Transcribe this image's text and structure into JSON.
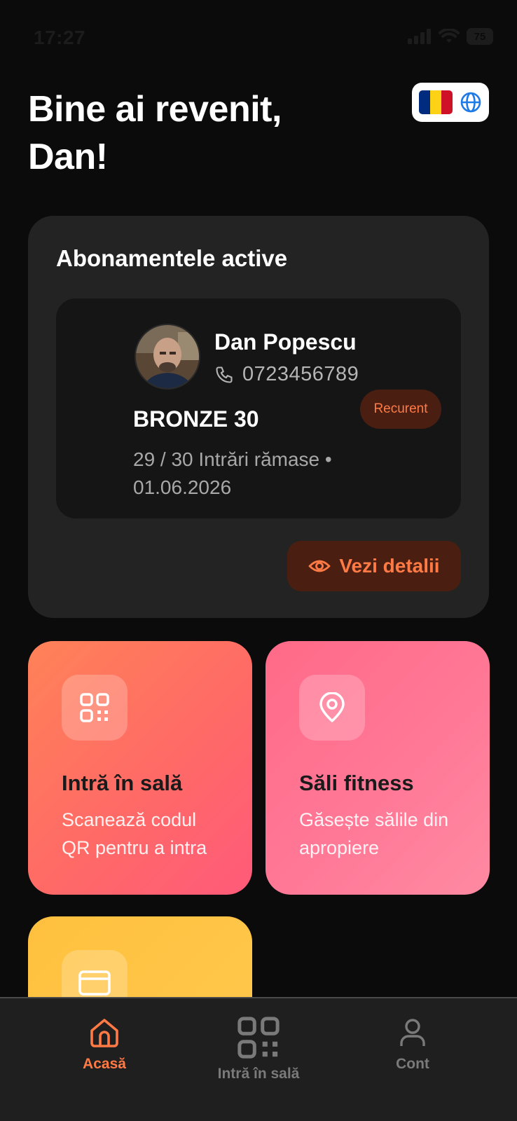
{
  "status_bar": {
    "time": "17:27",
    "battery": "75"
  },
  "greeting": "Bine ai revenit, Dan!",
  "subscriptions": {
    "title": "Abonamentele active",
    "member": {
      "name": "Dan Popescu",
      "phone": "0723456789",
      "plan": "BRONZE 30",
      "info": "29 / 30 Intrări rămase  •  01.06.2026",
      "badge": "Recurent"
    },
    "details_button": "Vezi detalii"
  },
  "tiles": {
    "enter": {
      "title": "Intră în sală",
      "description": "Scanează codul QR pentru a intra"
    },
    "gyms": {
      "title": "Săli fitness",
      "description": "Găsește sălile din apropiere"
    }
  },
  "bottom_nav": {
    "home": "Acasă",
    "enter": "Intră în sală",
    "account": "Cont"
  },
  "colors": {
    "accent": "#ff7a45",
    "background": "#0b0b0b",
    "card": "#232323",
    "flag_blue": "#002b7f",
    "flag_yellow": "#fcd116",
    "flag_red": "#ce1126"
  },
  "icons": [
    "qr-code-icon",
    "map-pin-icon",
    "credit-card-icon",
    "home-icon",
    "user-icon",
    "eye-icon",
    "phone-icon",
    "globe-icon",
    "wifi-icon",
    "signal-icon"
  ]
}
